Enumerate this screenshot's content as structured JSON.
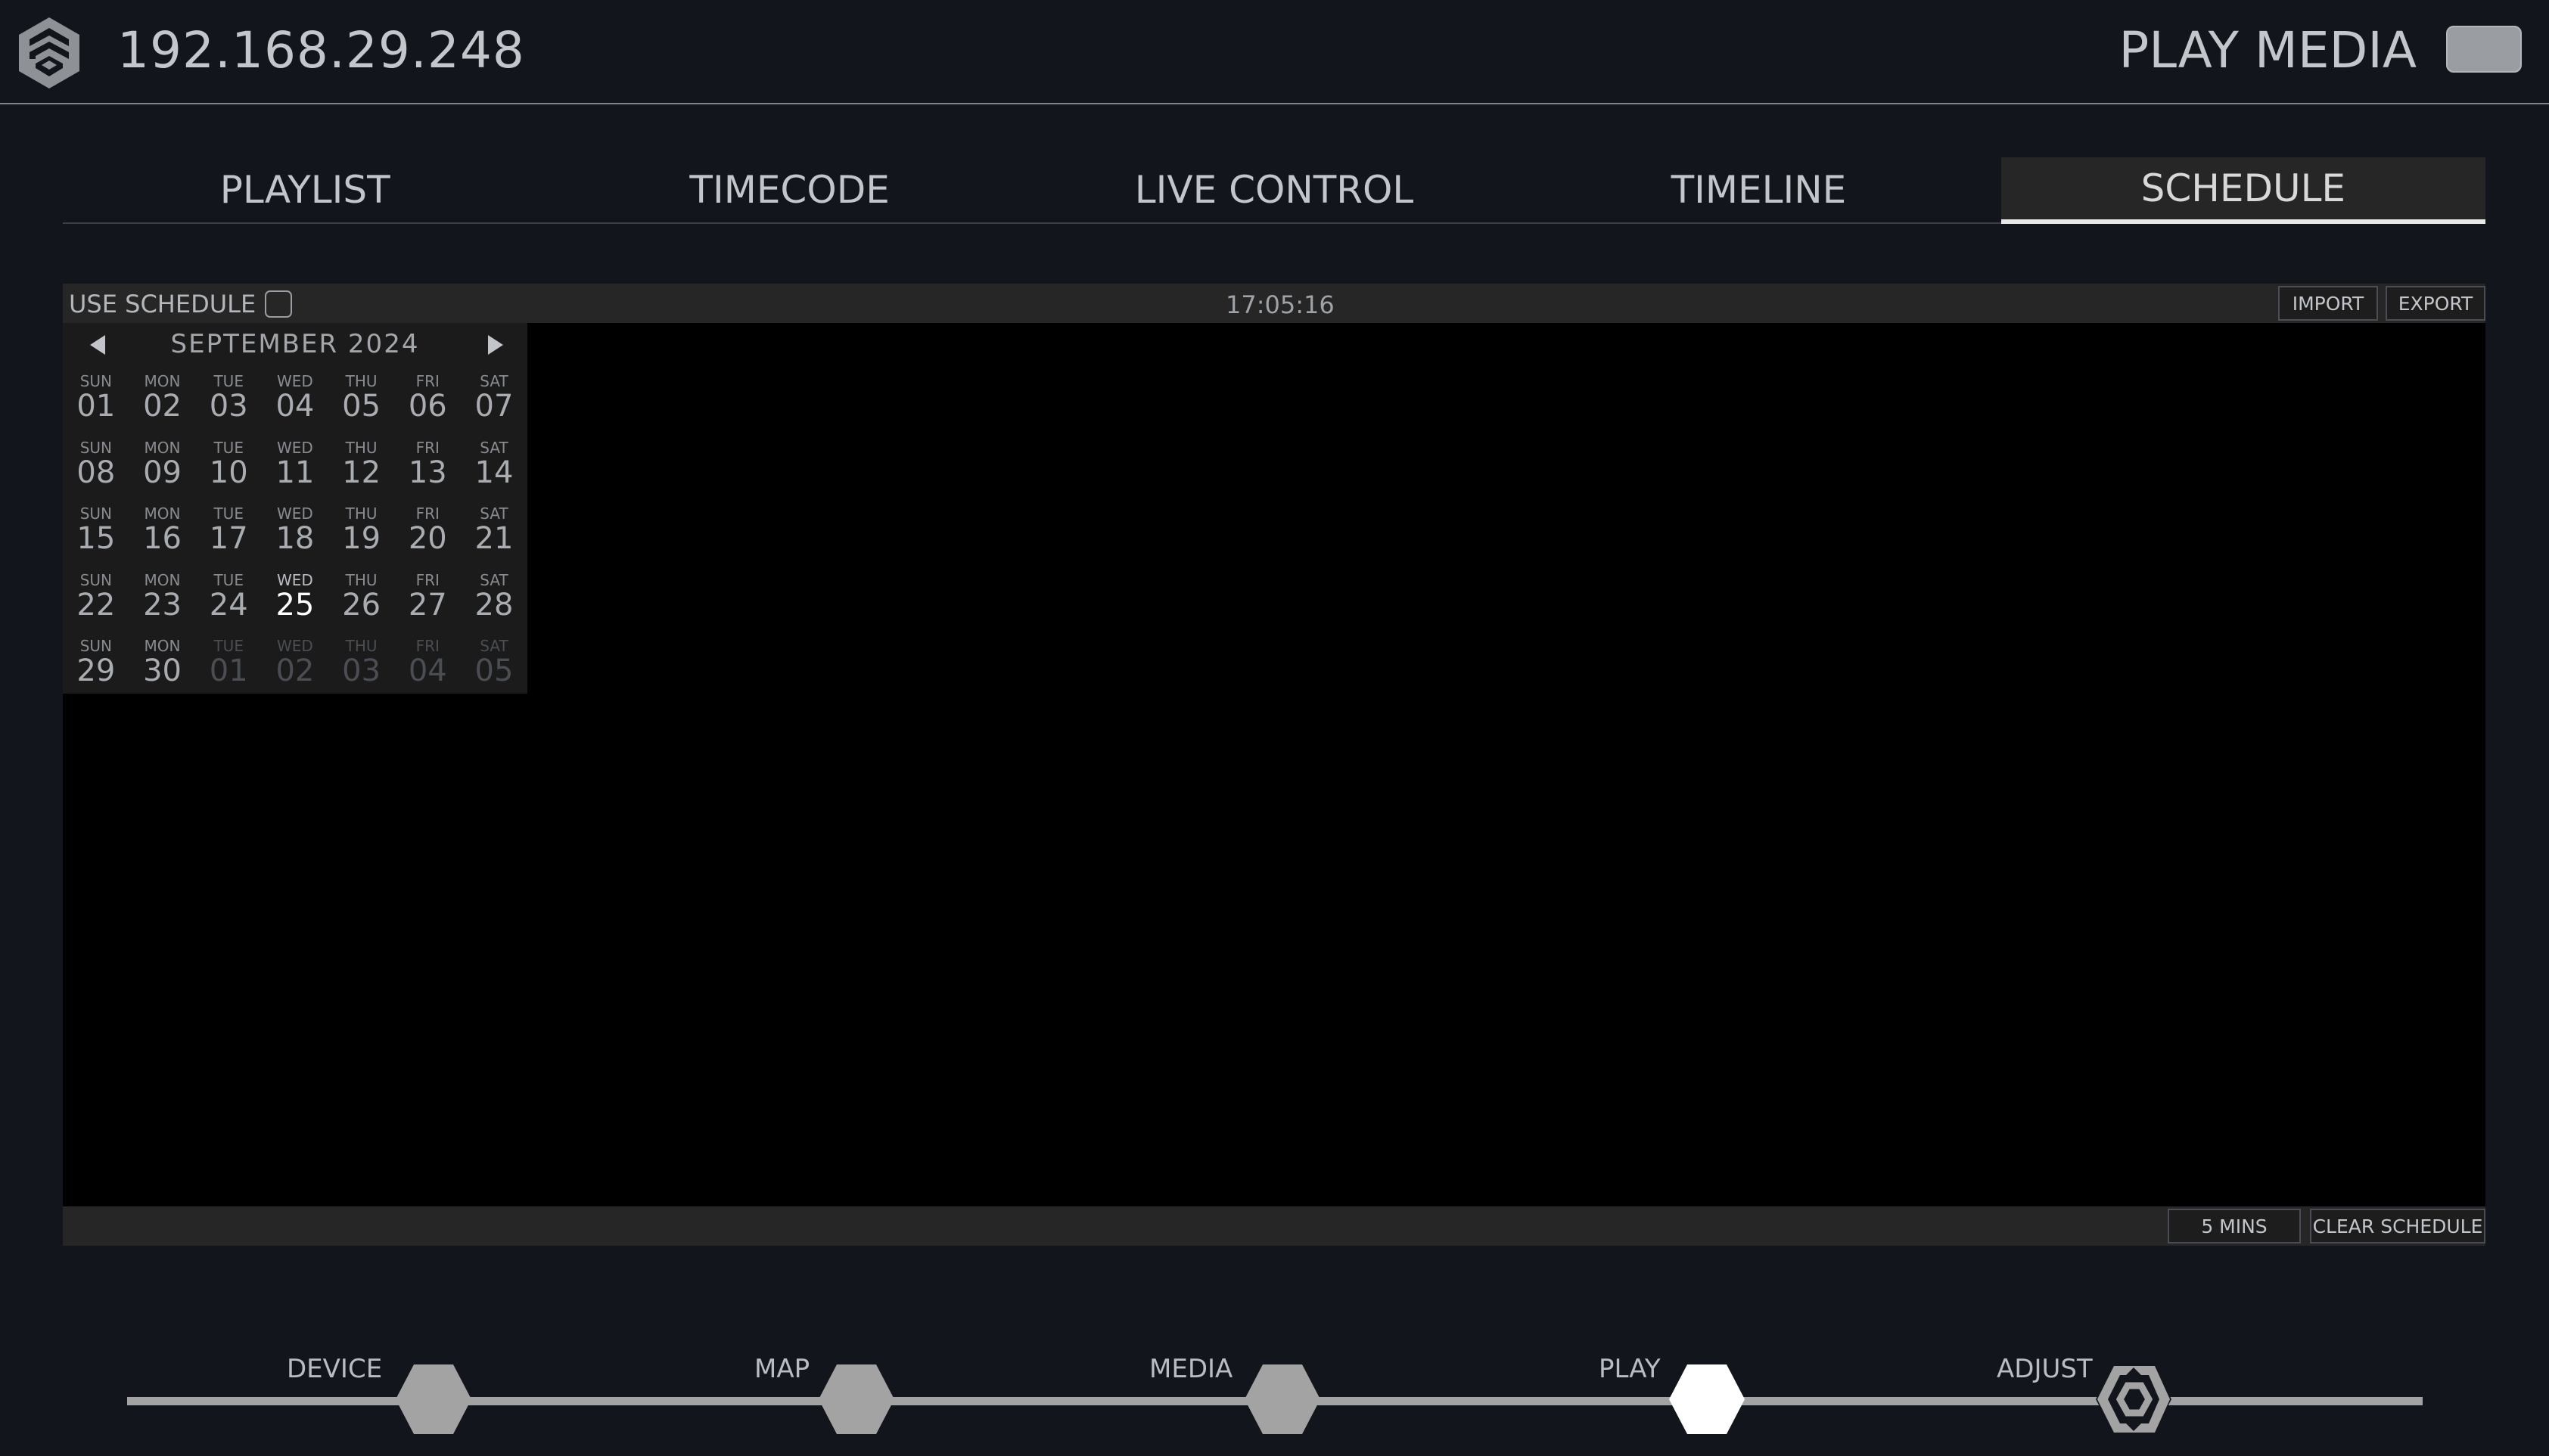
{
  "header": {
    "device_ip": "192.168.29.248",
    "play_media_label": "PLAY MEDIA"
  },
  "tabs": [
    {
      "label": "PLAYLIST",
      "active": false
    },
    {
      "label": "TIMECODE",
      "active": false
    },
    {
      "label": "LIVE CONTROL",
      "active": false
    },
    {
      "label": "TIMELINE",
      "active": false
    },
    {
      "label": "SCHEDULE",
      "active": true
    }
  ],
  "schedule": {
    "use_schedule_label": "USE SCHEDULE",
    "current_time": "17:05:16",
    "import_label": "IMPORT",
    "export_label": "EXPORT",
    "interval_label": "5 MINS",
    "clear_label": "CLEAR SCHEDULE"
  },
  "calendar": {
    "month_label": "SEPTEMBER 2024",
    "weekdays": [
      "SUN",
      "MON",
      "TUE",
      "WED",
      "THU",
      "FRI",
      "SAT"
    ],
    "days": [
      {
        "num": "01",
        "type": "current"
      },
      {
        "num": "02",
        "type": "current"
      },
      {
        "num": "03",
        "type": "current"
      },
      {
        "num": "04",
        "type": "current"
      },
      {
        "num": "05",
        "type": "current"
      },
      {
        "num": "06",
        "type": "current"
      },
      {
        "num": "07",
        "type": "current"
      },
      {
        "num": "08",
        "type": "current"
      },
      {
        "num": "09",
        "type": "current"
      },
      {
        "num": "10",
        "type": "current"
      },
      {
        "num": "11",
        "type": "current"
      },
      {
        "num": "12",
        "type": "current"
      },
      {
        "num": "13",
        "type": "current"
      },
      {
        "num": "14",
        "type": "current"
      },
      {
        "num": "15",
        "type": "current"
      },
      {
        "num": "16",
        "type": "current"
      },
      {
        "num": "17",
        "type": "current"
      },
      {
        "num": "18",
        "type": "current"
      },
      {
        "num": "19",
        "type": "current"
      },
      {
        "num": "20",
        "type": "current"
      },
      {
        "num": "21",
        "type": "current"
      },
      {
        "num": "22",
        "type": "current"
      },
      {
        "num": "23",
        "type": "current"
      },
      {
        "num": "24",
        "type": "current"
      },
      {
        "num": "25",
        "type": "today"
      },
      {
        "num": "26",
        "type": "current"
      },
      {
        "num": "27",
        "type": "current"
      },
      {
        "num": "28",
        "type": "current"
      },
      {
        "num": "29",
        "type": "current"
      },
      {
        "num": "30",
        "type": "current"
      },
      {
        "num": "01",
        "type": "other"
      },
      {
        "num": "02",
        "type": "other"
      },
      {
        "num": "03",
        "type": "other"
      },
      {
        "num": "04",
        "type": "other"
      },
      {
        "num": "05",
        "type": "other"
      }
    ]
  },
  "stepper": {
    "steps": [
      {
        "label": "DEVICE",
        "state": "done"
      },
      {
        "label": "MAP",
        "state": "done"
      },
      {
        "label": "MEDIA",
        "state": "done"
      },
      {
        "label": "PLAY",
        "state": "active"
      },
      {
        "label": "ADJUST",
        "state": "pending"
      }
    ]
  },
  "colors": {
    "background": "#12161c",
    "panel": "#262626",
    "canvas": "#000000",
    "step_done": "#a3a3a3",
    "step_active": "#ffffff"
  }
}
